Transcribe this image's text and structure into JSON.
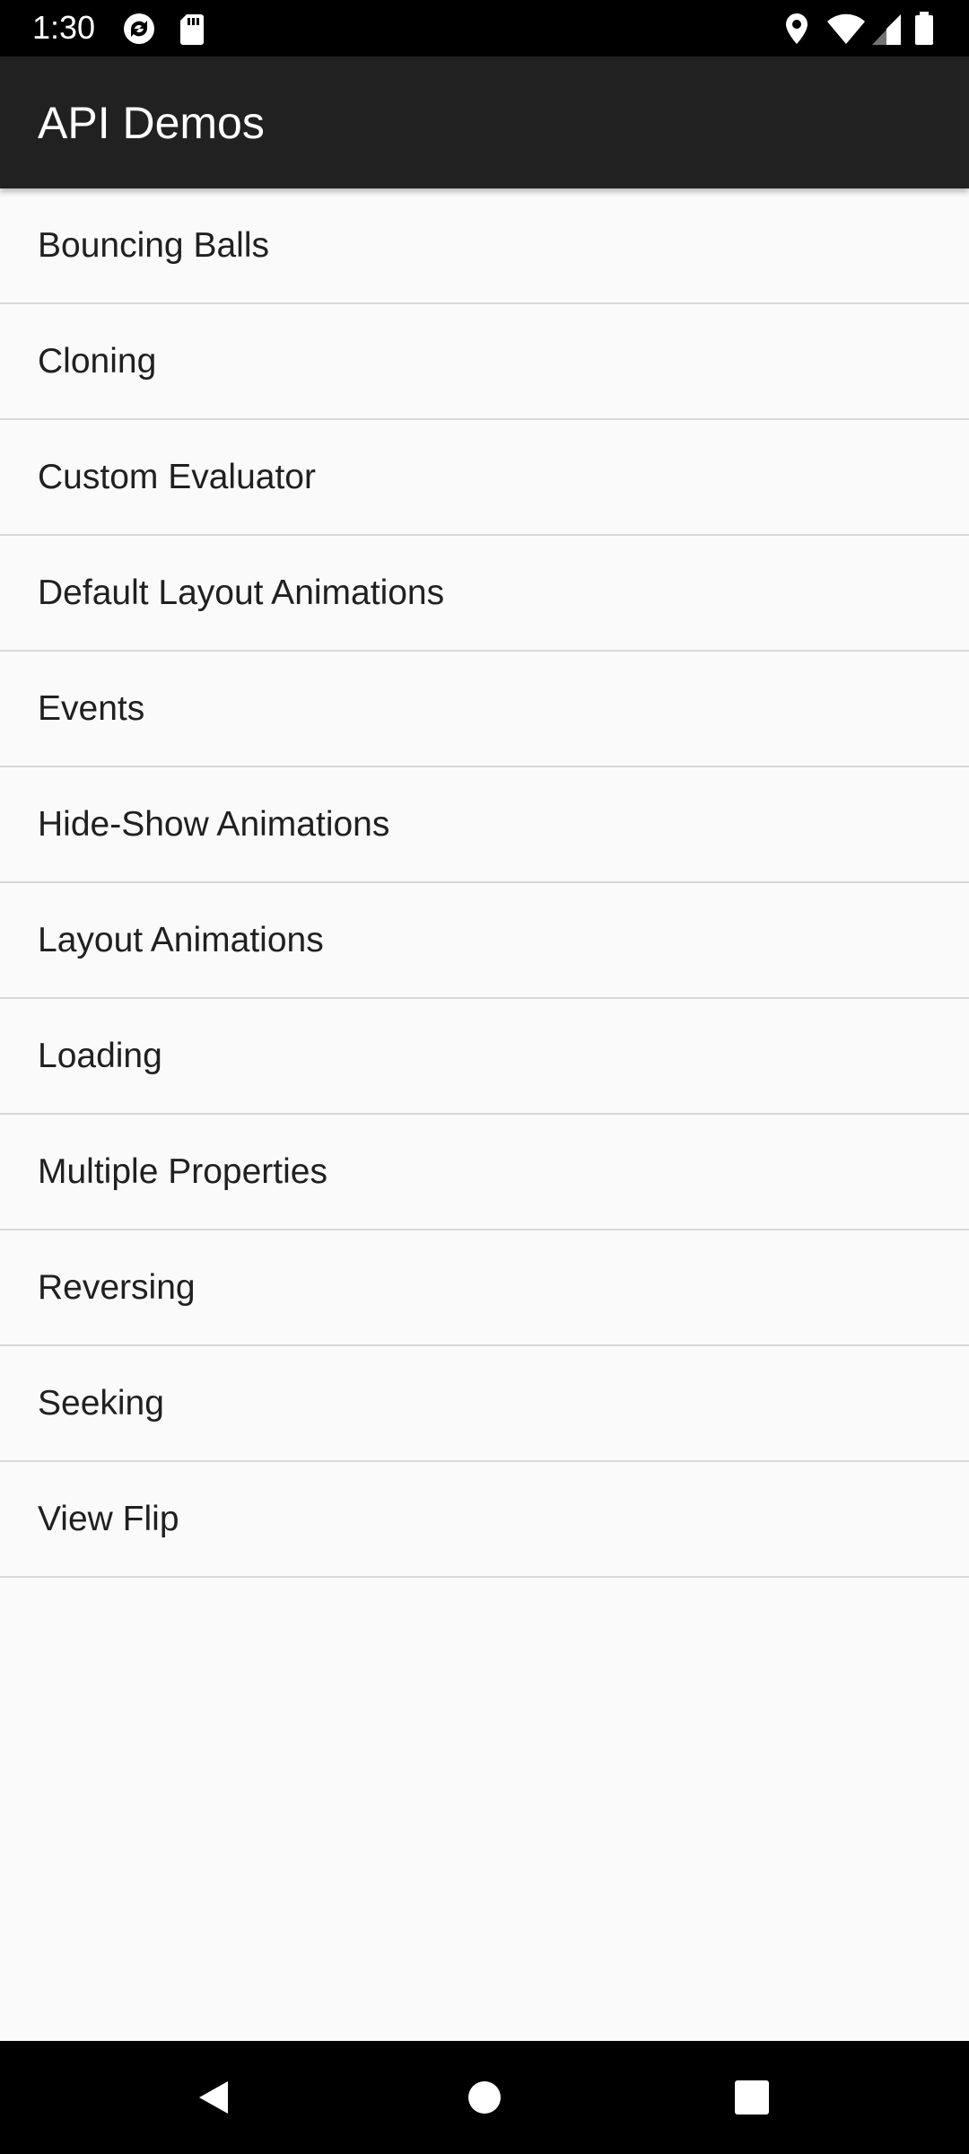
{
  "status_bar": {
    "time": "1:30",
    "icons": [
      "sync-icon",
      "sd-card-icon",
      "location-icon",
      "wifi-icon",
      "cell-signal-icon",
      "battery-icon"
    ]
  },
  "toolbar": {
    "title": "API Demos"
  },
  "list": {
    "items": [
      {
        "label": "Bouncing Balls"
      },
      {
        "label": "Cloning"
      },
      {
        "label": "Custom Evaluator"
      },
      {
        "label": "Default Layout Animations"
      },
      {
        "label": "Events"
      },
      {
        "label": "Hide-Show Animations"
      },
      {
        "label": "Layout Animations"
      },
      {
        "label": "Loading"
      },
      {
        "label": "Multiple Properties"
      },
      {
        "label": "Reversing"
      },
      {
        "label": "Seeking"
      },
      {
        "label": "View Flip"
      }
    ]
  },
  "nav_bar": {
    "buttons": [
      "back-icon",
      "home-icon",
      "recents-icon"
    ]
  },
  "colors": {
    "toolbar_bg": "#212121",
    "list_bg": "#fafafa",
    "divider": "#d8d8d8",
    "text": "#202020"
  }
}
